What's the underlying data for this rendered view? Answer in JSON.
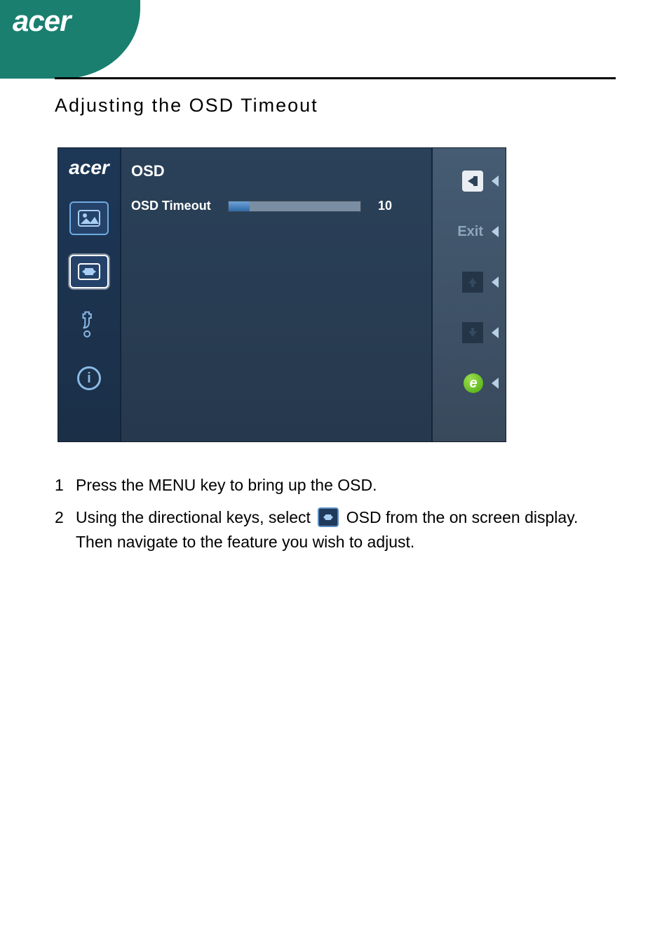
{
  "brand": "acer",
  "section_title": "Adjusting the OSD Timeout",
  "osd": {
    "brand": "acer",
    "heading": "OSD",
    "row_label": "OSD Timeout",
    "value": "10",
    "right": {
      "enter_icon": "enter",
      "exit_label": "Exit",
      "up_icon": "up",
      "down_icon": "down",
      "e_label": "e"
    }
  },
  "steps": [
    {
      "num": "1",
      "text_a": "Press the MENU key to bring up the OSD."
    },
    {
      "num": "2",
      "text_a": "Using the directional keys, select ",
      "text_b": " OSD from the on screen display. Then navigate to the feature you wish to adjust."
    }
  ]
}
